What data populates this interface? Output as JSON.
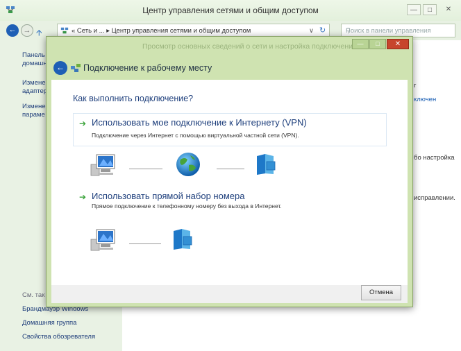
{
  "window": {
    "title": "Центр управления сетями и общим доступом",
    "minimize": "—",
    "maximize": "□",
    "close": "✕"
  },
  "address": {
    "path": "« Сеть и ...  ▸  Центр управления сетями и общим доступом",
    "dropdown": "∨",
    "refresh": "↻",
    "search_placeholder": "Поиск в панели управления"
  },
  "left_pane": {
    "items": [
      {
        "text": "Панель"
      },
      {
        "text": "домашн"
      },
      {
        "text": "Измене"
      },
      {
        "text": "адаптер"
      },
      {
        "text": "Измене"
      },
      {
        "text": "параме"
      }
    ],
    "see_also_header": "См. так",
    "links": [
      {
        "text": "Брандмауэр Windows"
      },
      {
        "text": "Домашняя группа"
      },
      {
        "text": "Свойства обозревателя"
      }
    ]
  },
  "main_partial": {
    "p1": "г",
    "p2": "ключен",
    "p3": "бо настройка",
    "p4": "исправлении."
  },
  "dialog": {
    "title": "Подключение к рабочему месту",
    "question": "Как выполнить подключение?",
    "options": [
      {
        "title": "Использовать мое подключение к Интернету (VPN)",
        "description": "Подключение через Интернет с помощью виртуальной частной сети (VPN)."
      },
      {
        "title": "Использовать прямой набор номера",
        "description": "Прямое подключение к телефонному номеру без выхода в Интернет."
      }
    ],
    "cancel": "Отмена",
    "dlg_close": "✕",
    "dlg_min": "—",
    "dlg_max": "□",
    "faded_subtitle": "Просмотр основных сведений о сети и настройка подключений"
  },
  "icons": {
    "computer": "computer-icon",
    "globe": "globe-icon",
    "server": "server-icon"
  }
}
